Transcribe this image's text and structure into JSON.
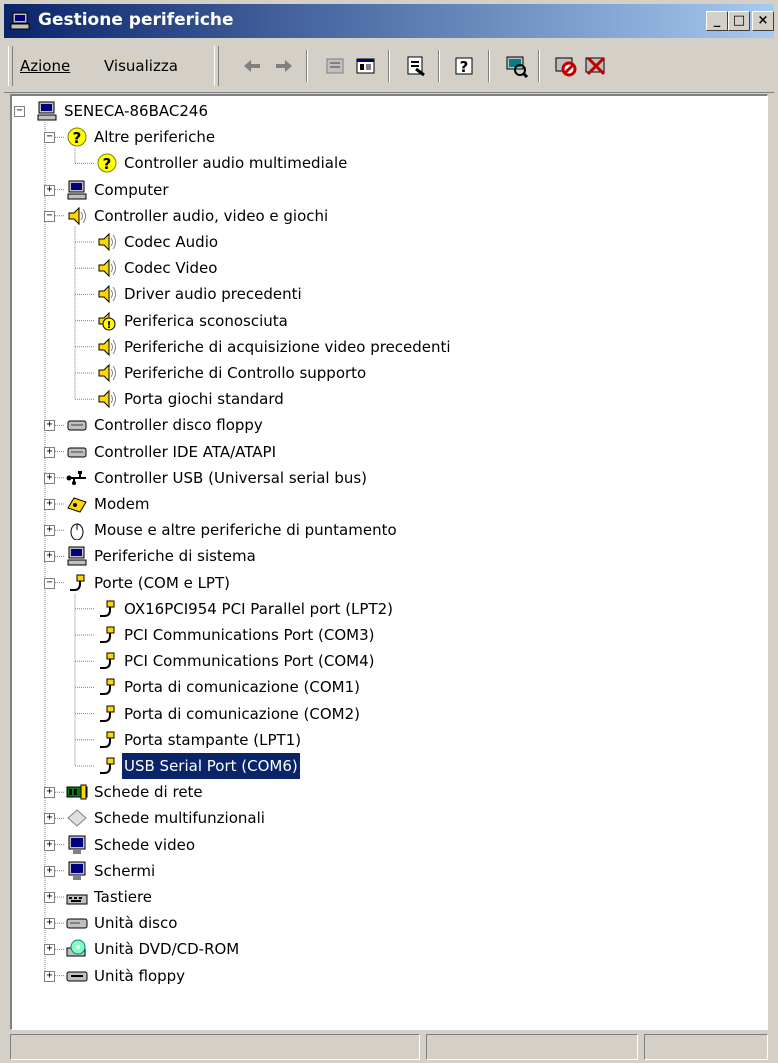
{
  "window": {
    "title": "Gestione periferiche",
    "minimize": "_",
    "maximize": "□",
    "close": "×"
  },
  "menu": {
    "azione": "Azione",
    "visualizza": "Visualizza"
  },
  "toolbar": [
    "back-arrow-icon",
    "forward-arrow-icon",
    "up-folder-icon",
    "show-hide-tree-icon",
    "properties-icon",
    "help-icon",
    "scan-hardware-icon",
    "disable-device-icon",
    "uninstall-device-icon"
  ],
  "tree": {
    "root": "SENECA-86BAC246",
    "items": [
      {
        "label": "Altre periferiche",
        "icon": "question-icon",
        "expanded": true,
        "children": [
          "Controller audio multimediale"
        ]
      },
      {
        "label": "Computer",
        "icon": "computer-icon",
        "expanded": false
      },
      {
        "label": "Controller audio, video e giochi",
        "icon": "speaker-icon",
        "expanded": true,
        "children": [
          "Codec Audio",
          "Codec Video",
          "Driver audio precedenti",
          "Periferica sconosciuta",
          "Periferiche di acquisizione video precedenti",
          "Periferiche di Controllo supporto",
          "Porta giochi standard"
        ]
      },
      {
        "label": "Controller disco floppy",
        "icon": "controller-icon",
        "expanded": false
      },
      {
        "label": "Controller IDE ATA/ATAPI",
        "icon": "controller-icon",
        "expanded": false
      },
      {
        "label": "Controller USB (Universal serial bus)",
        "icon": "usb-icon",
        "expanded": false
      },
      {
        "label": "Modem",
        "icon": "modem-icon",
        "expanded": false
      },
      {
        "label": "Mouse e altre periferiche di puntamento",
        "icon": "mouse-icon",
        "expanded": false
      },
      {
        "label": "Periferiche di sistema",
        "icon": "computer-icon",
        "expanded": false
      },
      {
        "label": "Porte (COM e LPT)",
        "icon": "port-icon",
        "expanded": true,
        "children": [
          "OX16PCI954 PCI Parallel port (LPT2)",
          "PCI Communications Port (COM3)",
          "PCI Communications Port (COM4)",
          "Porta di comunicazione (COM1)",
          "Porta di comunicazione (COM2)",
          "Porta stampante (LPT1)",
          "USB Serial Port (COM6)"
        ]
      },
      {
        "label": "Schede di rete",
        "icon": "network-card-icon",
        "expanded": false
      },
      {
        "label": "Schede multifunzionali",
        "icon": "multifunction-icon",
        "expanded": false
      },
      {
        "label": "Schede video",
        "icon": "monitor-icon",
        "expanded": false
      },
      {
        "label": "Schermi",
        "icon": "monitor-icon",
        "expanded": false
      },
      {
        "label": "Tastiere",
        "icon": "keyboard-icon",
        "expanded": false
      },
      {
        "label": "Unità disco",
        "icon": "disk-icon",
        "expanded": false
      },
      {
        "label": "Unità DVD/CD-ROM",
        "icon": "cdrom-icon",
        "expanded": false
      },
      {
        "label": "Unità floppy",
        "icon": "floppy-icon",
        "expanded": false
      }
    ],
    "selected": "USB Serial Port (COM6)"
  },
  "colors": {
    "titlebar_start": "#0a246a",
    "titlebar_end": "#a6caf0",
    "selection": "#0a246a",
    "face": "#d4d0c8"
  }
}
